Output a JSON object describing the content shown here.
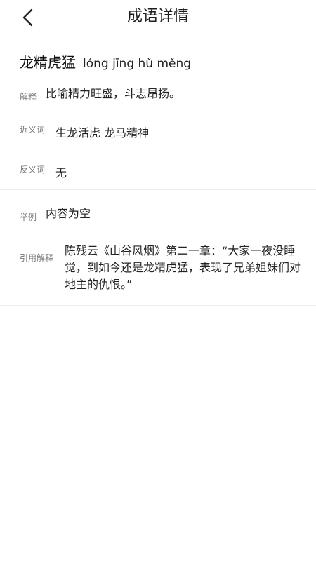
{
  "header": {
    "title": "成语详情"
  },
  "idiom": {
    "word": "龙精虎猛",
    "pinyin": "lóng jīng hǔ měng"
  },
  "rows": {
    "explanation": {
      "label": "解释",
      "value": "比喻精力旺盛，斗志昂扬。"
    },
    "synonyms": {
      "label": "近义词",
      "value": "生龙活虎 龙马精神"
    },
    "antonyms": {
      "label": "反义词",
      "value": "无"
    },
    "example": {
      "label": "举例",
      "value": "内容为空"
    },
    "citation": {
      "label": "引用解释",
      "value": "陈残云《山谷风烟》第二一章：“大家一夜没睡觉，到如今还是龙精虎猛，表现了兄弟姐妹们对地主的仇恨。”"
    }
  }
}
